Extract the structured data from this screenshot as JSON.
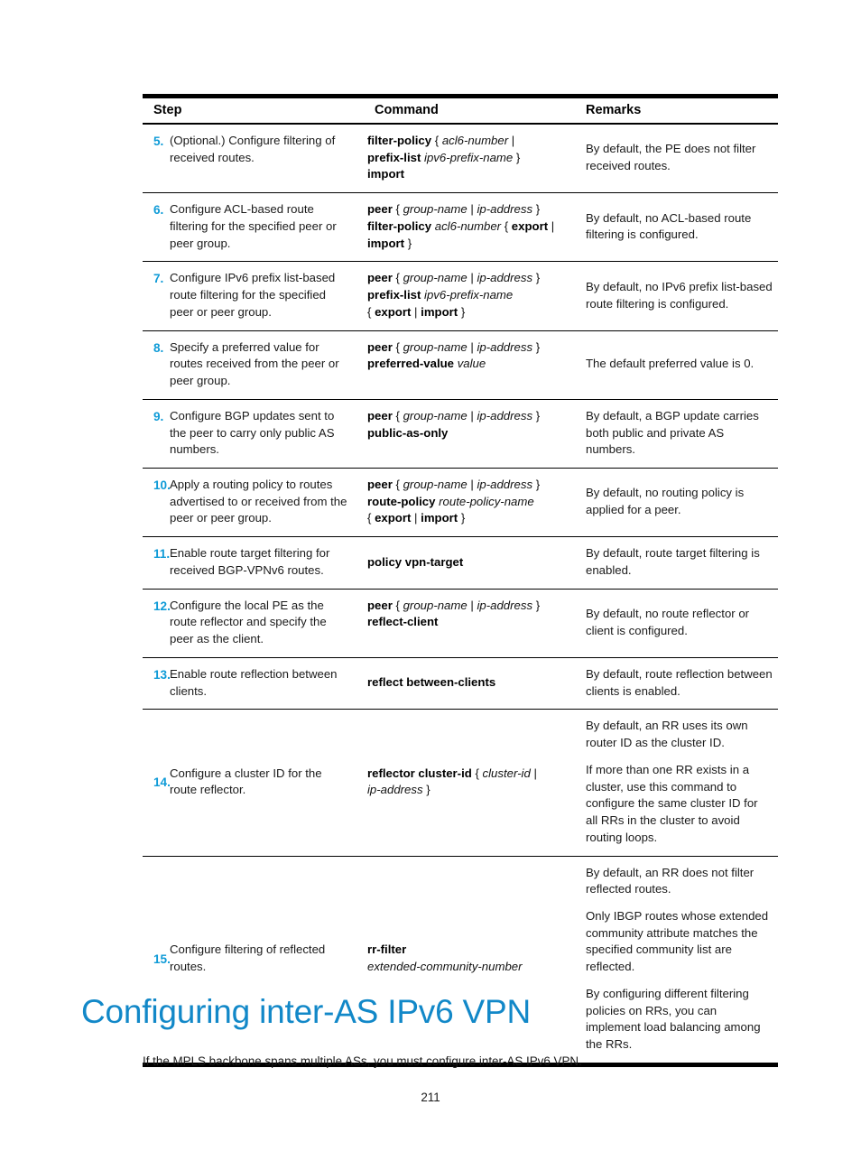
{
  "table": {
    "headers": {
      "step": "Step",
      "command": "Command",
      "remarks": "Remarks"
    },
    "rows": [
      {
        "num": "5.",
        "desc": "(Optional.) Configure filtering of received routes.",
        "command_lines": [
          [
            {
              "t": "filter-policy",
              "s": "bold"
            },
            {
              "t": " { ",
              "s": "plain"
            },
            {
              "t": "acl6-number",
              "s": "italic"
            },
            {
              "t": " |",
              "s": "plain"
            }
          ],
          [
            {
              "t": "prefix-list",
              "s": "bold"
            },
            {
              "t": " ",
              "s": "plain"
            },
            {
              "t": "ipv6-prefix-name",
              "s": "italic"
            },
            {
              "t": " }",
              "s": "plain"
            }
          ],
          [
            {
              "t": "import",
              "s": "bold"
            }
          ]
        ],
        "remarks": [
          "By default, the PE does not filter received routes."
        ]
      },
      {
        "num": "6.",
        "desc": "Configure ACL-based route filtering for the specified peer or peer group.",
        "command_lines": [
          [
            {
              "t": "peer",
              "s": "bold"
            },
            {
              "t": " { ",
              "s": "plain"
            },
            {
              "t": "group-name",
              "s": "italic"
            },
            {
              "t": "  |  ",
              "s": "plain"
            },
            {
              "t": "ip-address",
              "s": "italic"
            },
            {
              "t": " }",
              "s": "plain"
            }
          ],
          [
            {
              "t": "filter-policy",
              "s": "bold"
            },
            {
              "t": " ",
              "s": "plain"
            },
            {
              "t": "acl6-number",
              "s": "italic"
            },
            {
              "t": " { ",
              "s": "plain"
            },
            {
              "t": "export",
              "s": "bold"
            },
            {
              "t": " |",
              "s": "plain"
            }
          ],
          [
            {
              "t": "import",
              "s": "bold"
            },
            {
              "t": " }",
              "s": "plain"
            }
          ]
        ],
        "remarks": [
          "By default, no ACL-based route filtering is configured."
        ]
      },
      {
        "num": "7.",
        "desc": "Configure IPv6 prefix list-based route filtering for the specified peer or peer group.",
        "command_lines": [
          [
            {
              "t": "peer",
              "s": "bold"
            },
            {
              "t": " { ",
              "s": "plain"
            },
            {
              "t": "group-name",
              "s": "italic"
            },
            {
              "t": "  |  ",
              "s": "plain"
            },
            {
              "t": "ip-address",
              "s": "italic"
            },
            {
              "t": " }",
              "s": "plain"
            }
          ],
          [
            {
              "t": "prefix-list",
              "s": "bold"
            },
            {
              "t": " ",
              "s": "plain"
            },
            {
              "t": "ipv6-prefix-name",
              "s": "italic"
            }
          ],
          [
            {
              "t": "{ ",
              "s": "plain"
            },
            {
              "t": "export",
              "s": "bold"
            },
            {
              "t": "  |  ",
              "s": "plain"
            },
            {
              "t": "import",
              "s": "bold"
            },
            {
              "t": " }",
              "s": "plain"
            }
          ]
        ],
        "remarks": [
          "By default, no IPv6 prefix list-based route filtering is configured."
        ]
      },
      {
        "num": "8.",
        "desc": "Specify a preferred value for routes received from the peer or peer group.",
        "command_lines": [
          [
            {
              "t": "peer",
              "s": "bold"
            },
            {
              "t": " { ",
              "s": "plain"
            },
            {
              "t": "group-name",
              "s": "italic"
            },
            {
              "t": "  |  ",
              "s": "plain"
            },
            {
              "t": "ip-address",
              "s": "italic"
            },
            {
              "t": " }",
              "s": "plain"
            }
          ],
          [
            {
              "t": "preferred-value",
              "s": "bold"
            },
            {
              "t": " ",
              "s": "plain"
            },
            {
              "t": "value",
              "s": "italic"
            }
          ]
        ],
        "remarks": [
          "The default preferred value is 0."
        ]
      },
      {
        "num": "9.",
        "desc": "Configure BGP updates sent to the peer to carry only public AS numbers.",
        "command_lines": [
          [
            {
              "t": "peer",
              "s": "bold"
            },
            {
              "t": " { ",
              "s": "plain"
            },
            {
              "t": "group-name",
              "s": "italic"
            },
            {
              "t": "  |  ",
              "s": "plain"
            },
            {
              "t": "ip-address",
              "s": "italic"
            },
            {
              "t": " }",
              "s": "plain"
            }
          ],
          [
            {
              "t": "public-as-only",
              "s": "bold"
            }
          ]
        ],
        "remarks": [
          "By default, a BGP update carries both public and private AS numbers."
        ]
      },
      {
        "num": "10.",
        "desc": "Apply a routing policy to routes advertised to or received from the peer or peer group.",
        "command_lines": [
          [
            {
              "t": "peer",
              "s": "bold"
            },
            {
              "t": " { ",
              "s": "plain"
            },
            {
              "t": "group-name",
              "s": "italic"
            },
            {
              "t": "  |  ",
              "s": "plain"
            },
            {
              "t": "ip-address",
              "s": "italic"
            },
            {
              "t": " }",
              "s": "plain"
            }
          ],
          [
            {
              "t": "route-policy",
              "s": "bold"
            },
            {
              "t": " ",
              "s": "plain"
            },
            {
              "t": "route-policy-name",
              "s": "italic"
            }
          ],
          [
            {
              "t": "{ ",
              "s": "plain"
            },
            {
              "t": "export",
              "s": "bold"
            },
            {
              "t": "  |  ",
              "s": "plain"
            },
            {
              "t": "import",
              "s": "bold"
            },
            {
              "t": " }",
              "s": "plain"
            }
          ]
        ],
        "remarks": [
          "By default, no routing policy is applied for a peer."
        ]
      },
      {
        "num": "11.",
        "desc": "Enable route target filtering for received BGP-VPNv6 routes.",
        "command_lines": [
          [
            {
              "t": "policy vpn-target",
              "s": "bold"
            }
          ]
        ],
        "command_mid": true,
        "remarks": [
          "By default, route target filtering is enabled."
        ]
      },
      {
        "num": "12.",
        "desc": "Configure the local PE as the route reflector and specify the peer as the client.",
        "command_lines": [
          [
            {
              "t": "peer",
              "s": "bold"
            },
            {
              "t": " { ",
              "s": "plain"
            },
            {
              "t": "group-name",
              "s": "italic"
            },
            {
              "t": "  |  ",
              "s": "plain"
            },
            {
              "t": "ip-address",
              "s": "italic"
            },
            {
              "t": " }",
              "s": "plain"
            }
          ],
          [
            {
              "t": "reflect-client",
              "s": "bold"
            }
          ]
        ],
        "remarks": [
          "By default, no route reflector or client is configured."
        ]
      },
      {
        "num": "13.",
        "desc": "Enable route reflection between clients.",
        "command_lines": [
          [
            {
              "t": "reflect between-clients",
              "s": "bold"
            }
          ]
        ],
        "command_mid": true,
        "remarks": [
          "By default, route reflection between clients is enabled."
        ]
      },
      {
        "num": "14.",
        "desc": "Configure a cluster ID for the route reflector.",
        "desc_mid": true,
        "command_mid": true,
        "command_lines": [
          [
            {
              "t": "reflector cluster-id",
              "s": "bold"
            },
            {
              "t": " { ",
              "s": "plain"
            },
            {
              "t": "cluster-id",
              "s": "italic"
            },
            {
              "t": " |",
              "s": "plain"
            }
          ],
          [
            {
              "t": "ip-address",
              "s": "italic"
            },
            {
              "t": " }",
              "s": "plain"
            }
          ]
        ],
        "remarks": [
          "By default, an RR uses its own router ID as the cluster ID.",
          "If more than one RR exists in a cluster, use this command to configure the same cluster ID for all RRs in the cluster to avoid routing loops."
        ]
      },
      {
        "num": "15.",
        "desc": "Configure filtering of reflected routes.",
        "desc_mid": true,
        "command_mid": true,
        "command_lines": [
          [
            {
              "t": "rr-filter",
              "s": "bold"
            }
          ],
          [
            {
              "t": "extended-community-number",
              "s": "italic"
            }
          ]
        ],
        "remarks": [
          "By default, an RR does not filter reflected routes.",
          "Only IBGP routes whose extended community attribute matches the specified community list are reflected.",
          "By configuring different filtering policies on RRs, you can implement load balancing among the RRs."
        ]
      }
    ]
  },
  "section": {
    "heading": "Configuring inter-AS IPv6 VPN",
    "paragraph": "If the MPLS backbone spans multiple ASs, you must configure inter-AS IPv6 VPN."
  },
  "footer": {
    "page_number": "211"
  },
  "colors": {
    "step_number": "#0f9bd7",
    "heading": "#1288c8",
    "rule": "#000000",
    "text": "#1a1a1a"
  }
}
